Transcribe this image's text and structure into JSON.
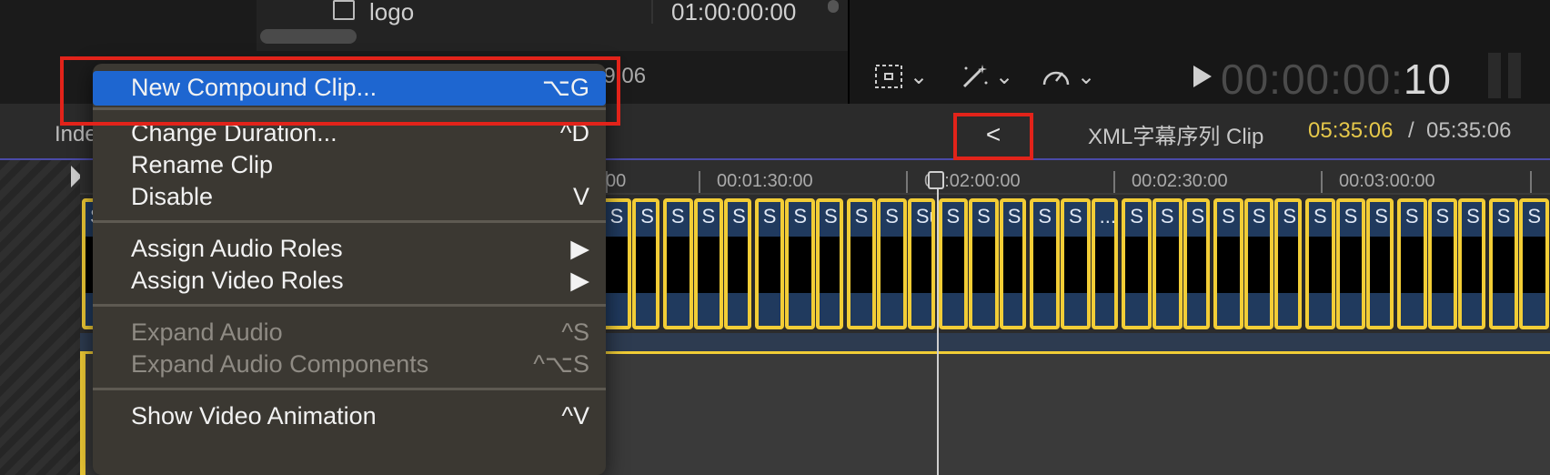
{
  "browser": {
    "row_name": "logo",
    "row_duration": "01:00:00:00",
    "timecode_fragment": "09:06"
  },
  "viewer": {
    "timecode_dim": "00:00:00:",
    "timecode_lit": "10"
  },
  "timeline": {
    "index_label": "Index",
    "back_symbol": "<",
    "clip_title": "XML字幕序列 Clip",
    "current_time": "05:35:06",
    "separator": "/",
    "total_time": "05:35:06",
    "ruler_ticks": [
      "00",
      "00:01:30:00",
      "00:02:00:00",
      "00:02:30:00",
      "00:03:00:00"
    ],
    "clip_head_labels": [
      "S",
      "S",
      "S",
      "S",
      "S",
      "S",
      "S",
      "S",
      "S",
      "Su",
      "S",
      "Su",
      "S",
      "Su",
      "S",
      "S",
      "S",
      "S",
      "S",
      "S",
      "S",
      "S",
      "S",
      "S",
      "S",
      "S",
      "S",
      "Su",
      "S",
      "S",
      "S",
      "S",
      "S",
      "...",
      "S",
      "S",
      "S",
      "S",
      "S",
      "S",
      "S",
      "S",
      "S",
      "S",
      "S",
      "S",
      "S",
      "S"
    ]
  },
  "menu": {
    "items": [
      {
        "label": "New Compound Clip...",
        "shortcut": "⌥G",
        "highlighted": true
      },
      {
        "label": "Change Duration...",
        "shortcut": "^D"
      },
      {
        "label": "Rename Clip",
        "shortcut": ""
      },
      {
        "label": "Disable",
        "shortcut": "V"
      },
      {
        "label": "Assign Audio Roles",
        "shortcut": "▶"
      },
      {
        "label": "Assign Video Roles",
        "shortcut": "▶"
      },
      {
        "label": "Expand Audio",
        "shortcut": "^S",
        "disabled": true
      },
      {
        "label": "Expand Audio Components",
        "shortcut": "^⌥S",
        "disabled": true
      },
      {
        "label": "Show Video Animation",
        "shortcut": "^V"
      }
    ]
  },
  "colors": {
    "accent_highlight": "#1e66d0",
    "annotation_red": "#e2231a",
    "clip_border": "#f2cd36",
    "current_time": "#e6c84a"
  }
}
